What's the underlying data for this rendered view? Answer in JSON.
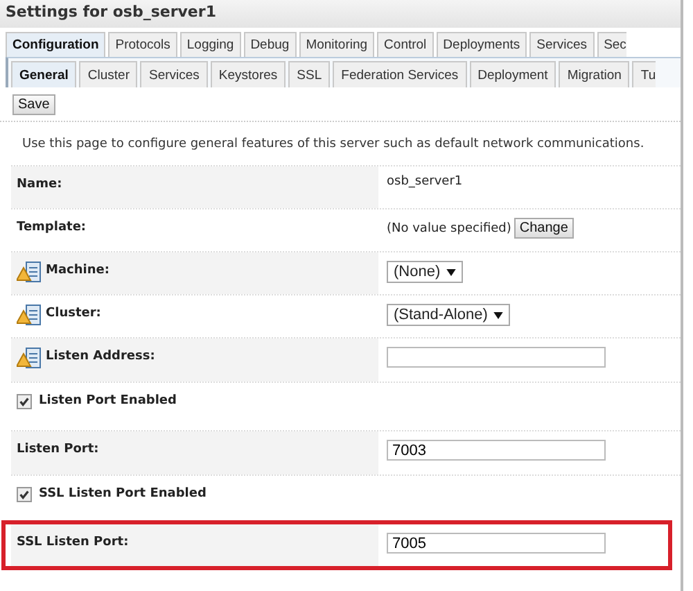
{
  "title": "Settings for osb_server1",
  "tabs": [
    {
      "label": "Configuration",
      "selected": true
    },
    {
      "label": "Protocols",
      "selected": false
    },
    {
      "label": "Logging",
      "selected": false
    },
    {
      "label": "Debug",
      "selected": false
    },
    {
      "label": "Monitoring",
      "selected": false
    },
    {
      "label": "Control",
      "selected": false
    },
    {
      "label": "Deployments",
      "selected": false
    },
    {
      "label": "Services",
      "selected": false
    },
    {
      "label": "Sec",
      "selected": false
    }
  ],
  "subtabs": [
    {
      "label": "General",
      "selected": true
    },
    {
      "label": "Cluster",
      "selected": false
    },
    {
      "label": "Services",
      "selected": false
    },
    {
      "label": "Keystores",
      "selected": false
    },
    {
      "label": "SSL",
      "selected": false
    },
    {
      "label": "Federation Services",
      "selected": false
    },
    {
      "label": "Deployment",
      "selected": false
    },
    {
      "label": "Migration",
      "selected": false
    },
    {
      "label": "Tu",
      "selected": false
    }
  ],
  "save_button": "Save",
  "description": "Use this page to configure general features of this server such as default network communications.",
  "rows": [
    {
      "kind": "text",
      "label": "Name:",
      "value": "osb_server1",
      "icon": false,
      "highlighted": false
    },
    {
      "kind": "template",
      "label": "Template:",
      "value": "(No value specified)",
      "button": "Change",
      "icon": false,
      "highlighted": false
    },
    {
      "kind": "select",
      "label": "Machine:",
      "value": "(None)",
      "icon": true,
      "highlighted": false
    },
    {
      "kind": "select",
      "label": "Cluster:",
      "value": "(Stand-Alone)",
      "icon": true,
      "highlighted": false
    },
    {
      "kind": "input",
      "label": "Listen Address:",
      "value": "",
      "icon": true,
      "highlighted": false
    },
    {
      "kind": "checkbox",
      "label": "Listen Port Enabled",
      "checked": true,
      "highlighted": false
    },
    {
      "kind": "input",
      "label": "Listen Port:",
      "value": "7003",
      "icon": false,
      "highlighted": false
    },
    {
      "kind": "checkbox",
      "label": "SSL Listen Port Enabled",
      "checked": true,
      "highlighted": false
    },
    {
      "kind": "input",
      "label": "SSL Listen Port:",
      "value": "7005",
      "icon": false,
      "highlighted": true
    }
  ]
}
